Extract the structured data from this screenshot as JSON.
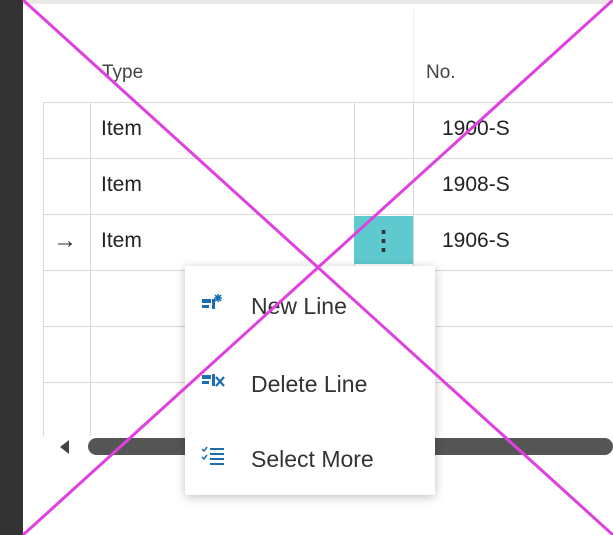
{
  "grid": {
    "columns": {
      "type": "Type",
      "no": "No."
    },
    "rows": [
      {
        "type": "Item",
        "no": "1900-S"
      },
      {
        "type": "Item",
        "no": "1908-S"
      },
      {
        "type": "Item",
        "no": "1906-S"
      }
    ],
    "current_row_indicator": "→",
    "row_actions_glyph": "⋮"
  },
  "context_menu": {
    "items": [
      {
        "label": "New Line",
        "icon": "new-line-icon"
      },
      {
        "label": "Delete Line",
        "icon": "delete-line-icon"
      },
      {
        "label": "Select More",
        "icon": "select-more-icon"
      }
    ]
  },
  "colors": {
    "accent": "#5ec9cf",
    "annotation_cross": "#e040e0",
    "icon_blue": "#1a6fb0"
  }
}
